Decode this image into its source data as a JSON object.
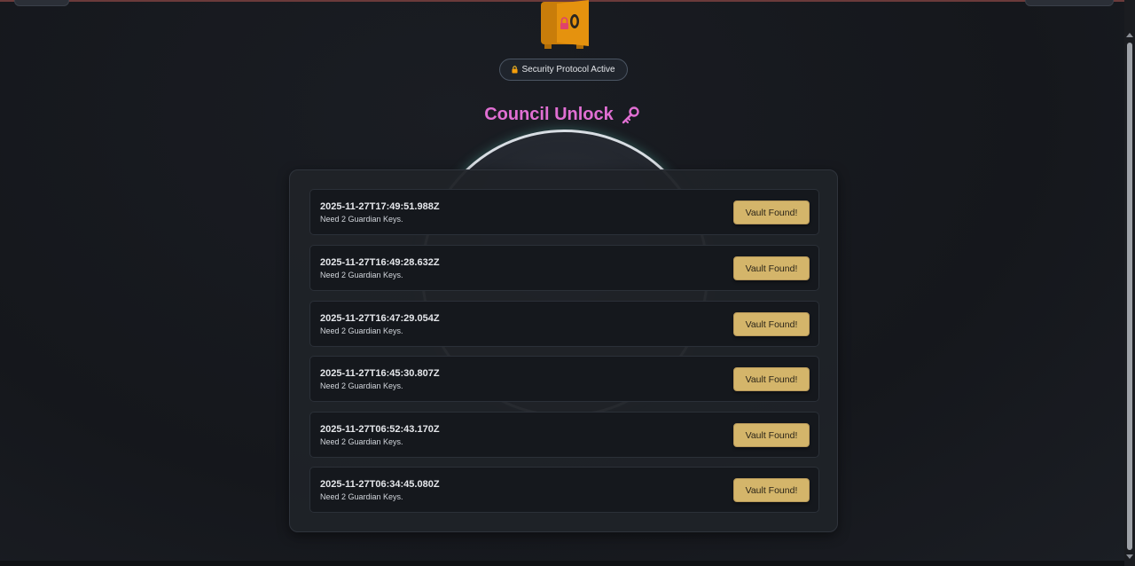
{
  "header": {
    "badge_text": "Security Protocol Active",
    "title": "Council Unlock"
  },
  "colors": {
    "accent_title": "#e16fd3",
    "button_gold": "#d4b56a",
    "vault_orange": "#e5920e"
  },
  "entries": [
    {
      "timestamp": "2025-11-27T17:49:51.988Z",
      "message": "Need 2 Guardian Keys.",
      "button": "Vault Found!"
    },
    {
      "timestamp": "2025-11-27T16:49:28.632Z",
      "message": "Need 2 Guardian Keys.",
      "button": "Vault Found!"
    },
    {
      "timestamp": "2025-11-27T16:47:29.054Z",
      "message": "Need 2 Guardian Keys.",
      "button": "Vault Found!"
    },
    {
      "timestamp": "2025-11-27T16:45:30.807Z",
      "message": "Need 2 Guardian Keys.",
      "button": "Vault Found!"
    },
    {
      "timestamp": "2025-11-27T06:52:43.170Z",
      "message": "Need 2 Guardian Keys.",
      "button": "Vault Found!"
    },
    {
      "timestamp": "2025-11-27T06:34:45.080Z",
      "message": "Need 2 Guardian Keys.",
      "button": "Vault Found!"
    }
  ],
  "icons": {
    "vault": "vault-icon",
    "lock": "lock-icon",
    "key": "key-icon"
  }
}
